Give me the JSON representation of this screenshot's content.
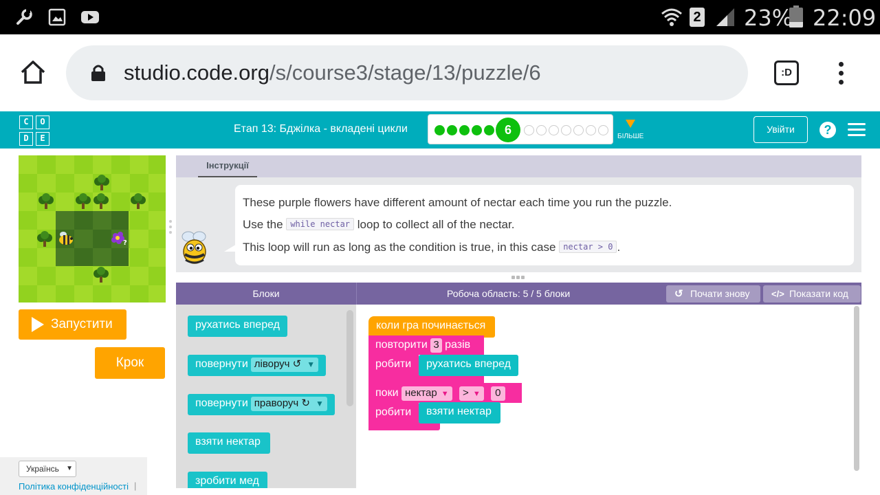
{
  "status_bar": {
    "battery": "23%",
    "time": "22:09",
    "sim": "2",
    "left_icons": [
      "wrench-icon",
      "image-icon",
      "youtube-icon"
    ],
    "right_icons": [
      "wifi-icon",
      "sim-icon",
      "signal-icon",
      "battery-icon"
    ]
  },
  "browser": {
    "url_host": "studio.code.org",
    "url_path": "/s/course3/stage/13/puzzle/6",
    "icons": [
      "home-icon",
      "lock-icon",
      "tab-switcher-icon",
      "overflow-menu-icon"
    ],
    "tabs_badge": ":D"
  },
  "header": {
    "logo_letters": [
      "C",
      "O",
      "D",
      "E"
    ],
    "stage_title": "Етап 13: Бджілка - вкладені цикли",
    "progress": {
      "completed": 5,
      "current": "6",
      "remaining": 7
    },
    "more_label": "БІЛЬШЕ",
    "signin_label": "Увійти",
    "help_symbol": "?",
    "accent": "#00adbc"
  },
  "game": {
    "run_label": "Запустити",
    "step_label": "Крок"
  },
  "footer": {
    "language": "Українсь",
    "privacy_link": "Політика конфіденційності",
    "separator": "|"
  },
  "instructions": {
    "tab_label": "Інструкції",
    "line1": "These purple flowers have different amount of nectar each time you run the puzzle.",
    "line2_pre": "Use the",
    "line2_code": "while nectar",
    "line2_post": "loop to collect all of the nectar.",
    "line3_pre": "This loop will run as long as the condition is true, in this case",
    "line3_code": "nectar > 0",
    "line3_post": "."
  },
  "workspace_header": {
    "toolbox_label": "Блоки",
    "workspace_label": "Робоча область: 5 / 5 блоки",
    "reset_label": "Почати знову",
    "show_code_label": "Показати код",
    "header_color": "#7665a0"
  },
  "toolbox": {
    "move_forward": "рухатись вперед",
    "turn_left_prefix": "повернути",
    "turn_left_value": "ліворуч ↺",
    "turn_right_prefix": "повернути",
    "turn_right_value": "праворуч ↻",
    "get_nectar": "взяти нектар",
    "make_honey": "зробити мед"
  },
  "program": {
    "when_run": "коли гра починається",
    "repeat_prefix": "повторити",
    "repeat_count": "3",
    "repeat_suffix": "разів",
    "do_label_1": "робити",
    "move_forward": "рухатись вперед",
    "while_prefix": "поки",
    "while_var": "нектар",
    "while_op": ">",
    "while_value": "0",
    "do_label_2": "робити",
    "get_nectar": "взяти нектар"
  }
}
